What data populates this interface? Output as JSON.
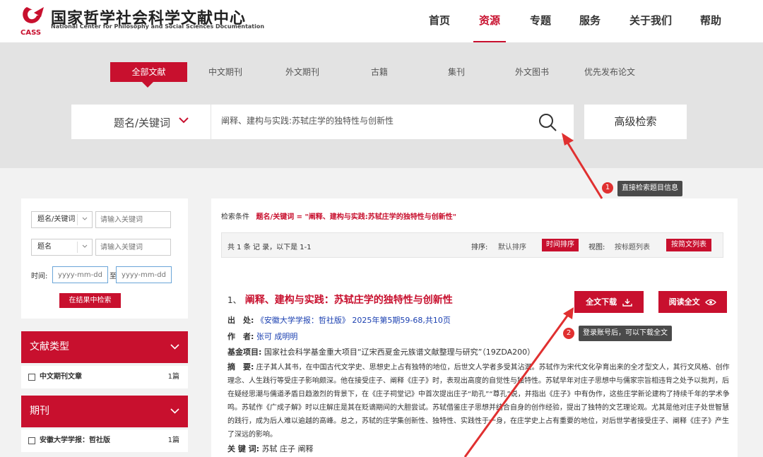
{
  "header": {
    "logo_cn": "国家哲学社会科学文献中心",
    "logo_en": "National Center for Philosophy and Social Sciences Documentation",
    "logo_mark": "CASS",
    "nav": [
      "首页",
      "资源",
      "专题",
      "服务",
      "关于我们",
      "帮助"
    ],
    "nav_active": "资源"
  },
  "tabs": [
    "全部文献",
    "中文期刊",
    "外文期刊",
    "古籍",
    "集刊",
    "外文图书",
    "优先发布论文"
  ],
  "tabs_active": "全部文献",
  "search": {
    "field_select": "题名/关键词",
    "query": "阐释、建构与实践:苏轼庄学的独特性与创新性",
    "advanced_button": "高级检索"
  },
  "filter": {
    "row1_select": "题名/关键词",
    "row1_placeholder": "请输入关键词",
    "row2_select": "题名",
    "row2_placeholder": "请输入关键词",
    "time_label": "时间:",
    "date_from_placeholder": "yyyy-mm-dd",
    "date_to_label": "至",
    "date_to_placeholder": "yyyy-mm-dd",
    "search_in_results": "在结果中检索"
  },
  "facets": {
    "doc_type_title": "文献类型",
    "doc_type_items": [
      {
        "label": "中文期刊文章",
        "count": "1篇"
      }
    ],
    "journal_title": "期刊",
    "journal_items": [
      {
        "label": "安徽大学学报：哲社版",
        "count": "1篇"
      }
    ]
  },
  "results": {
    "condition_label": "检索条件",
    "condition_value": "题名/关键词 = \"阐释、建构与实践:苏轼庄学的独特性与创新性\"",
    "summary": "共 1 条 记 录，以下是 1-1",
    "sort_label": "排序:",
    "sort_default": "默认排序",
    "sort_time": "时间排序",
    "view_label": "视图:",
    "view_title_list": "按标题列表",
    "view_abstract_list": "按简文列表"
  },
  "item": {
    "index": "1、",
    "title": "阐释、建构与实践：苏轼庄学的独特性与创新性",
    "source_label": "出　处:",
    "source_value": "《安徽大学学报：哲社版》 2025年第5期59-68,共10页",
    "author_label": "作　者:",
    "author_value": "张可  成明明",
    "fund_label": "基金项目:",
    "fund_value": "国家社会科学基金重大项目“辽宋西夏金元族谱文献整理与研究”（19ZDA200）",
    "abstract_label": "摘　要:",
    "abstract_text": "庄子其人其书，在中国古代文学史、思想史上占有独特的地位，后世文人学者多受其沾溉。苏轼作为宋代文化孕育出来的全才型文人，其行文风格、创作理念、人生践行等受庄子影响颇深。他在接受庄子、阐释《庄子》时，表现出高度的自觉性与独特性。苏轼早年对庄子思想中与儒家宗旨相违背之处予以批判，后在疑经思潮与儒道矛盾日趋激烈的背景下，在《庄子祠堂记》中首次提出庄子“助孔”“尊孔”说，并指出《庄子》中有伪作，这些庄学新论建构了持续千年的学术争鸣。苏轼作《广成子解》时以庄解庄是其在贬谪期间的大胆尝试。苏轼借鉴庄子思想并结合自身的创作经验，提出了独特的文艺理论观。尤其是他对庄子处世智慧的践行，成为后人难以逾越的高峰。总之，苏轼的庄学集创新性、独特性、实践性于一身，在庄学史上占有重要的地位，对后世学者接受庄子、阐释《庄子》产生了深远的影响。",
    "keywords_label": "关 键 词:",
    "keywords_value": "苏轼  庄子  阐释",
    "download_button": "全文下载",
    "read_button": "阅读全文"
  },
  "annotations": [
    {
      "num": "1",
      "text": "直接检索题目信息"
    },
    {
      "num": "2",
      "text": "登录账号后，可以下载全文"
    }
  ],
  "colors": {
    "accent": "#c8102e",
    "link": "#1a3fb0",
    "annotation_bg": "#4a4a4a"
  }
}
